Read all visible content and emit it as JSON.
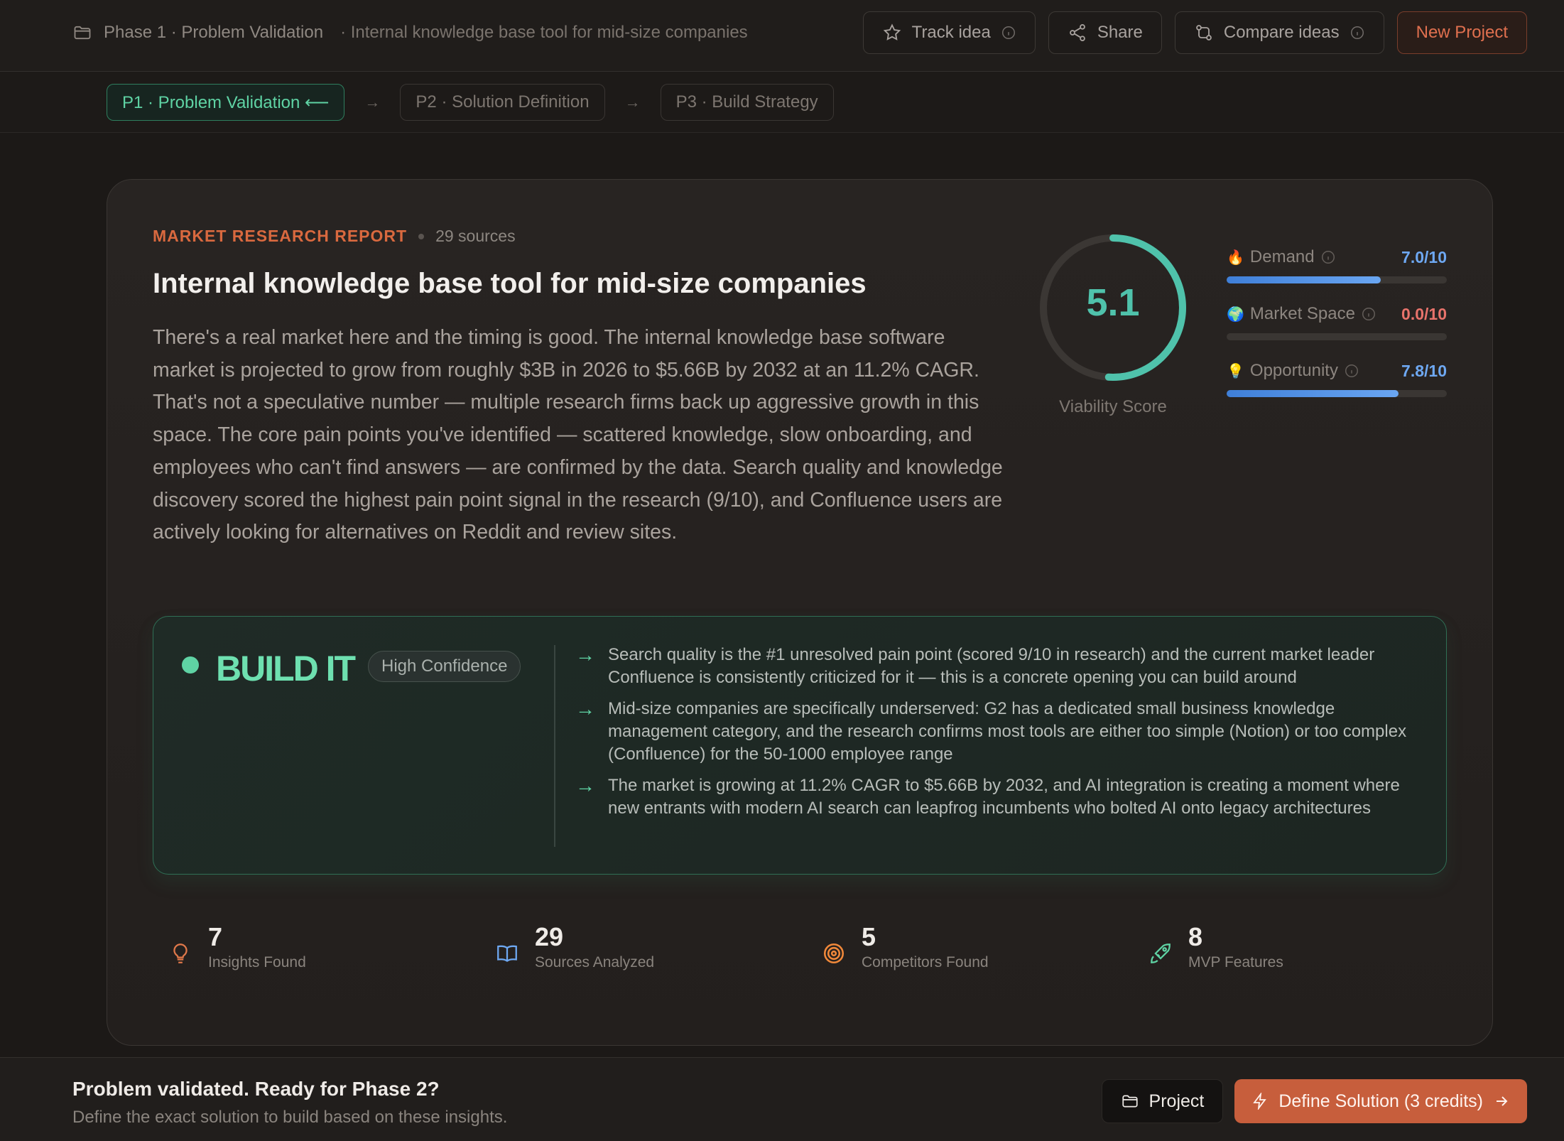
{
  "header": {
    "phase_label": "Phase 1 · Problem Validation",
    "project_label": "· Internal knowledge base tool for mid-size companies",
    "actions": {
      "track": "Track idea",
      "share": "Share",
      "compare": "Compare ideas",
      "new_project": "New Project"
    }
  },
  "phases": [
    {
      "label": "P1 · Problem Validation ⟵",
      "active": true
    },
    {
      "label": "P2 · Solution Definition",
      "active": false
    },
    {
      "label": "P3 · Build Strategy",
      "active": false
    }
  ],
  "report": {
    "eyebrow": "MARKET RESEARCH REPORT",
    "sources": "29 sources",
    "title": "Internal knowledge base tool for mid-size companies",
    "summary": "There's a real market here and the timing is good. The internal knowledge base software market is projected to grow from roughly $3B in 2026 to $5.66B by 2032 at an 11.2% CAGR. That's not a speculative number — multiple research firms back up aggressive growth in this space. The core pain points you've identified — scattered knowledge, slow onboarding, and employees who can't find answers — are confirmed by the data. Search quality and knowledge discovery scored the highest pain point signal in the research (9/10), and Confluence users are actively looking for alternatives on Reddit and review sites.",
    "viability": {
      "score": "5.1",
      "score_fraction": 0.51,
      "label": "Viability Score",
      "color": "#4fc2ab"
    },
    "metrics": [
      {
        "emoji": "🔥",
        "name": "Demand",
        "value": "7.0/10",
        "fraction": 0.7,
        "color": "#6ea8f2"
      },
      {
        "emoji": "🌍",
        "name": "Market Space",
        "value": "0.0/10",
        "fraction": 0.0,
        "color": "#e8736b"
      },
      {
        "emoji": "💡",
        "name": "Opportunity",
        "value": "7.8/10",
        "fraction": 0.78,
        "color": "#6ea8f2"
      }
    ],
    "verdict": {
      "label": "BUILD IT",
      "confidence": "High Confidence",
      "reasons": [
        "Search quality is the #1 unresolved pain point (scored 9/10 in research) and the current market leader Confluence is consistently criticized for it — this is a concrete opening you can build around",
        "Mid-size companies are specifically underserved: G2 has a dedicated small business knowledge management category, and the research confirms most tools are either too simple (Notion) or too complex (Confluence) for the 50-1000 employee range",
        "The market is growing at 11.2% CAGR to $5.66B by 2032, and AI integration is creating a moment where new entrants with modern AI search can leapfrog incumbents who bolted AI onto legacy architectures"
      ]
    },
    "stats": [
      {
        "icon": "lightbulb-icon",
        "number": "7",
        "label": "Insights Found"
      },
      {
        "icon": "book-icon",
        "number": "29",
        "label": "Sources Analyzed"
      },
      {
        "icon": "target-icon",
        "number": "5",
        "label": "Competitors Found"
      },
      {
        "icon": "rocket-icon",
        "number": "8",
        "label": "MVP Features"
      }
    ]
  },
  "footer": {
    "title": "Problem validated. Ready for Phase 2?",
    "subtitle": "Define the exact solution to build based on these insights.",
    "project_button": "Project",
    "cta_button": "Define Solution (3 credits)"
  }
}
